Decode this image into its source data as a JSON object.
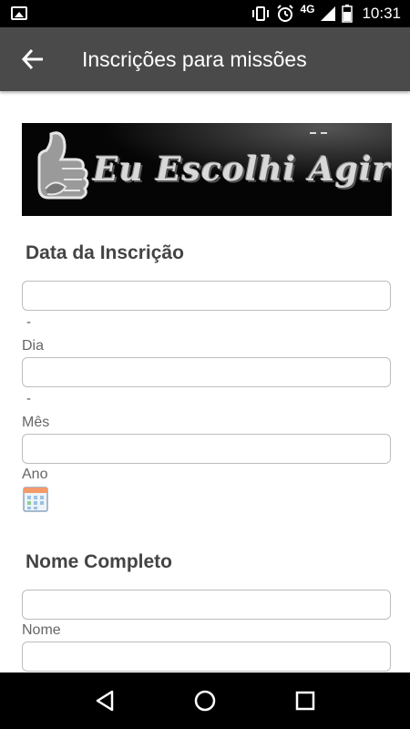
{
  "status_bar": {
    "time": "10:31",
    "network": "4G",
    "icons": [
      "image-icon",
      "vibrate-icon",
      "alarm-icon",
      "signal-icon",
      "battery-icon"
    ]
  },
  "app_bar": {
    "title": "Inscrições para missões",
    "back_icon": "arrow-back-icon"
  },
  "banner": {
    "text": "Eu Escolhi Agir!"
  },
  "sections": {
    "date": {
      "title": "Data da Inscrição",
      "separator_1": "-",
      "label_day": "Dia",
      "separator_2": "-",
      "label_month": "Mês",
      "label_year": "Ano",
      "day_value": "",
      "month_value": "",
      "year_value": ""
    },
    "name": {
      "title": "Nome Completo",
      "label_first": "Nome",
      "first_value": "",
      "last_value": ""
    }
  },
  "nav_bar": {
    "icons": [
      "back-triangle-icon",
      "home-circle-icon",
      "recents-square-icon"
    ]
  },
  "colors": {
    "app_bar": "#4a4a4a",
    "status_bar": "#000000",
    "input_border": "#bdbdbd",
    "section_title": "#444444",
    "label": "#666666"
  }
}
